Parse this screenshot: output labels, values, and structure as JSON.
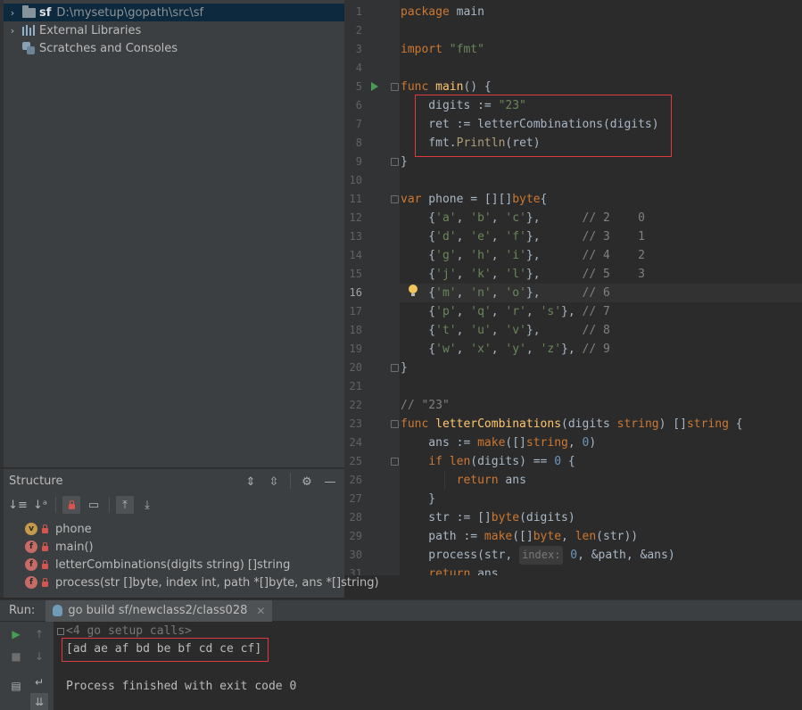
{
  "project_tree": {
    "items": [
      {
        "chevron": "›",
        "name": "sf",
        "path": "D:\\mysetup\\gopath\\src\\sf"
      },
      {
        "chevron": "›",
        "label": "External Libraries"
      },
      {
        "label": "Scratches and Consoles"
      }
    ]
  },
  "structure": {
    "title": "Structure",
    "items": [
      {
        "badge": "v",
        "label": "phone"
      },
      {
        "badge": "f",
        "label": "main()"
      },
      {
        "badge": "f",
        "label": "letterCombinations(digits string) []string"
      },
      {
        "badge": "f",
        "label": "process(str []byte, index int, path *[]byte, ans *[]string)"
      }
    ]
  },
  "editor": {
    "line_numbers": [
      "1",
      "2",
      "3",
      "4",
      "5",
      "6",
      "7",
      "8",
      "9",
      "10",
      "11",
      "12",
      "13",
      "14",
      "15",
      "16",
      "17",
      "18",
      "19",
      "20",
      "21",
      "22",
      "23",
      "24",
      "25",
      "26",
      "27",
      "28",
      "29",
      "30",
      "31"
    ],
    "current_line": "16",
    "param_hint": "index:",
    "lines": [
      [
        "package main"
      ],
      [
        ""
      ],
      [
        "import \"fmt\""
      ],
      [
        ""
      ],
      [
        "func main() {"
      ],
      [
        "    digits := \"23\""
      ],
      [
        "    ret := letterCombinations(digits)"
      ],
      [
        "    fmt.Println(ret)"
      ],
      [
        "}"
      ],
      [
        ""
      ],
      [
        "var phone = [][]byte{"
      ],
      [
        "    {'a', 'b', 'c'},      // 2    0"
      ],
      [
        "    {'d', 'e', 'f'},      // 3    1"
      ],
      [
        "    {'g', 'h', 'i'},      // 4    2"
      ],
      [
        "    {'j', 'k', 'l'},      // 5    3"
      ],
      [
        "    {'m', 'n', 'o'},      // 6"
      ],
      [
        "    {'p', 'q', 'r', 's'}, // 7"
      ],
      [
        "    {'t', 'u', 'v'},      // 8"
      ],
      [
        "    {'w', 'x', 'y', 'z'}, // 9"
      ],
      [
        "}"
      ],
      [
        ""
      ],
      [
        "// \"23\""
      ],
      [
        "func letterCombinations(digits string) []string {"
      ],
      [
        "    ans := make([]string, 0)"
      ],
      [
        "    if len(digits) == 0 {"
      ],
      [
        "        return ans"
      ],
      [
        "    }"
      ],
      [
        "    str := []byte(digits)"
      ],
      [
        "    path := make([]byte, len(str))"
      ],
      [
        "    process(str, index: 0, &path, &ans)"
      ],
      [
        "    return ans"
      ]
    ]
  },
  "run": {
    "label": "Run:",
    "tab_title": "go build sf/newclass2/class028",
    "setup_calls": "<4 go setup calls>",
    "output": "[ad ae af bd be bf cd ce cf]",
    "exit_message": "Process finished with exit code 0"
  },
  "colors": {
    "keyword": "#cc7832",
    "function": "#ffc66d",
    "string": "#6a8759",
    "number": "#6897bb",
    "comment": "#808080",
    "highlight_box": "#e0393e"
  }
}
